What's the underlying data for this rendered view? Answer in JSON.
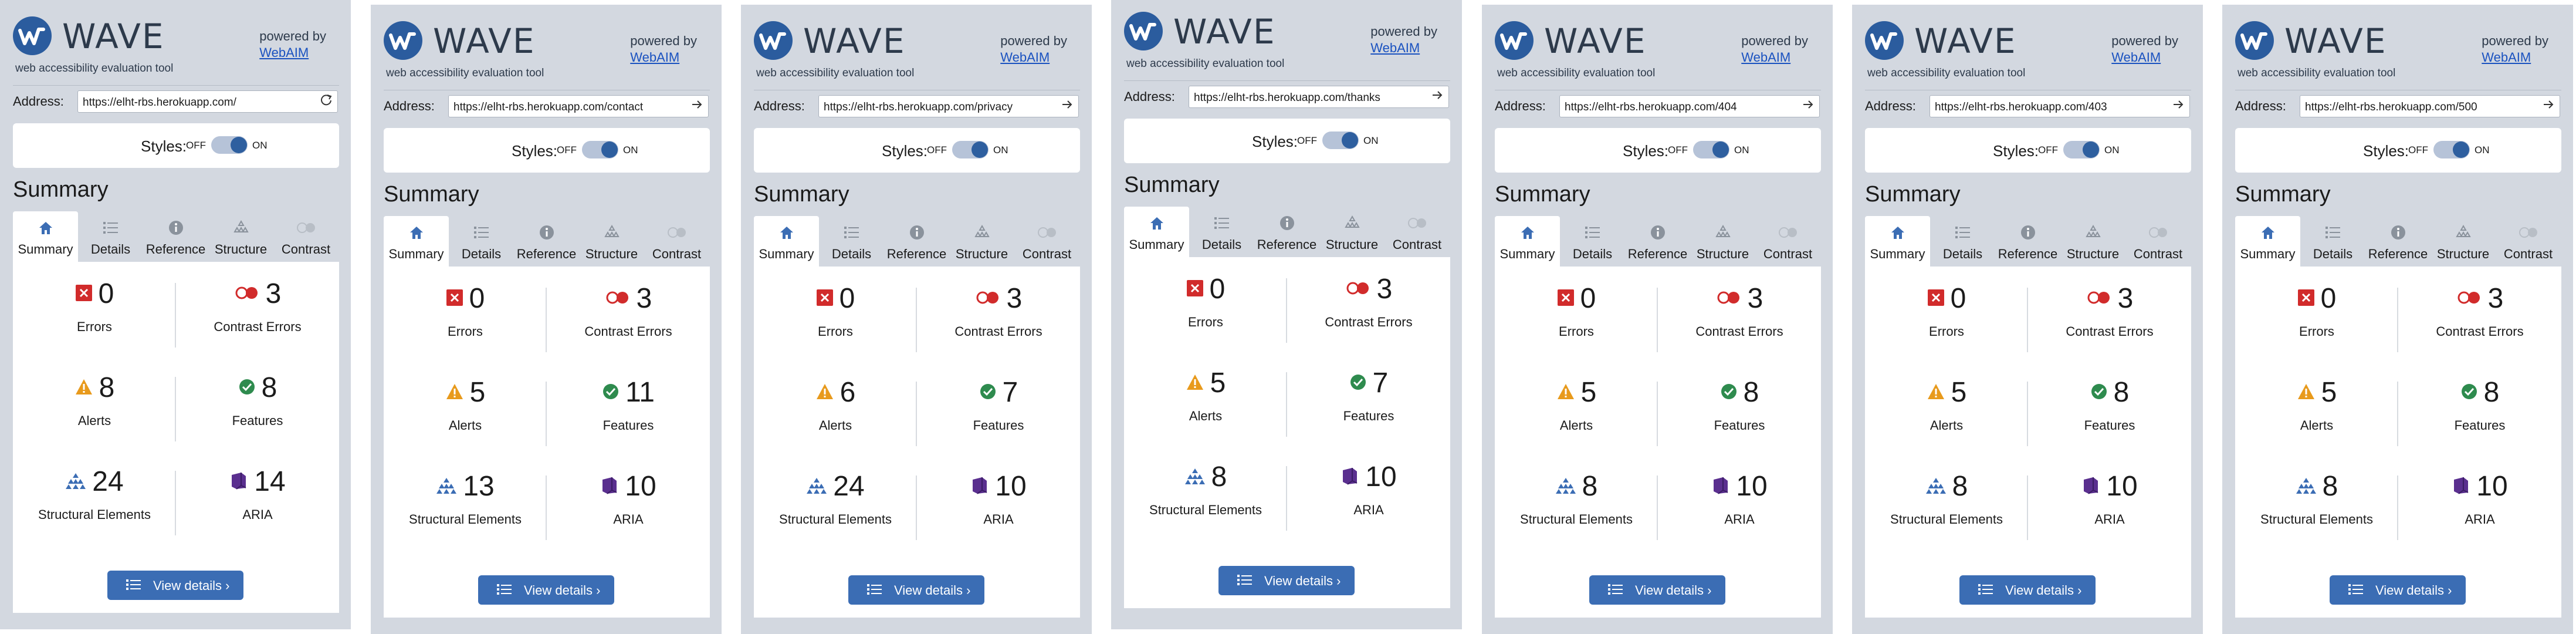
{
  "brand": {
    "logo_text": "WAVE",
    "subtitle": "web accessibility evaluation tool",
    "powered_by": "powered by",
    "powered_link": "WebAIM"
  },
  "labels": {
    "address": "Address:",
    "styles": "Styles:",
    "off": "OFF",
    "on": "ON",
    "summary": "Summary",
    "view_details": "View details ›"
  },
  "tabs": [
    "Summary",
    "Details",
    "Reference",
    "Structure",
    "Contrast"
  ],
  "metric_labels": {
    "errors": "Errors",
    "contrast": "Contrast Errors",
    "alerts": "Alerts",
    "features": "Features",
    "structural": "Structural Elements",
    "aria": "ARIA"
  },
  "colors": {
    "panel_bg": "#d3d8e0",
    "brand_blue": "#2b5c9e",
    "button_blue": "#3b6db4",
    "error_red": "#d12b2b",
    "alert_orange": "#e89a1c",
    "feature_green": "#2e8b4e",
    "aria_purple": "#5a2f8f",
    "structure_blue": "#3b6db4"
  },
  "panels": [
    {
      "url": "https://elht-rbs.herokuapp.com/",
      "address_icon": "reload-icon",
      "errors": "0",
      "contrast": "3",
      "alerts": "8",
      "features": "8",
      "structural": "24",
      "aria": "14"
    },
    {
      "url": "https://elht-rbs.herokuapp.com/contact",
      "address_icon": "arrow-right-icon",
      "errors": "0",
      "contrast": "3",
      "alerts": "5",
      "features": "11",
      "structural": "13",
      "aria": "10"
    },
    {
      "url": "https://elht-rbs.herokuapp.com/privacy",
      "address_icon": "arrow-right-icon",
      "errors": "0",
      "contrast": "3",
      "alerts": "6",
      "features": "7",
      "structural": "24",
      "aria": "10"
    },
    {
      "url": "https://elht-rbs.herokuapp.com/thanks",
      "address_icon": "arrow-right-icon",
      "errors": "0",
      "contrast": "3",
      "alerts": "5",
      "features": "7",
      "structural": "8",
      "aria": "10"
    },
    {
      "url": "https://elht-rbs.herokuapp.com/404",
      "address_icon": "arrow-right-icon",
      "errors": "0",
      "contrast": "3",
      "alerts": "5",
      "features": "8",
      "structural": "8",
      "aria": "10"
    },
    {
      "url": "https://elht-rbs.herokuapp.com/403",
      "address_icon": "arrow-right-icon",
      "errors": "0",
      "contrast": "3",
      "alerts": "5",
      "features": "8",
      "structural": "8",
      "aria": "10"
    },
    {
      "url": "https://elht-rbs.herokuapp.com/500",
      "address_icon": "arrow-right-icon",
      "errors": "0",
      "contrast": "3",
      "alerts": "5",
      "features": "8",
      "structural": "8",
      "aria": "10"
    }
  ]
}
